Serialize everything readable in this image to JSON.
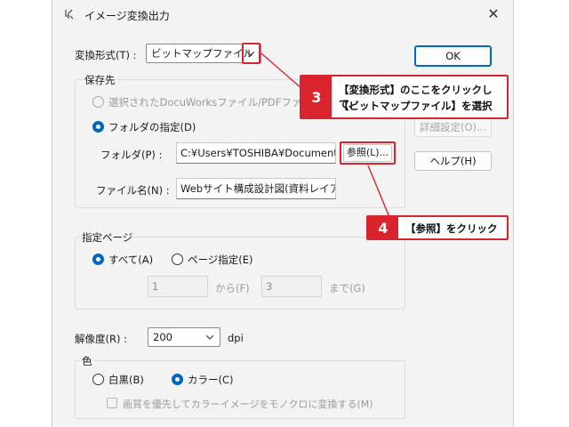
{
  "window": {
    "title": "イメージ変換出力"
  },
  "format": {
    "label": "変換形式(T) :",
    "value": "ビットマップファイル"
  },
  "save_group": {
    "title": "保存先",
    "option_selected_file": "選択されたDocuWorksファイル/PDFファイル",
    "option_folder": "フォルダの指定(D)",
    "folder_label": "フォルダ(P) :",
    "folder_value": "C:¥Users¥TOSHIBA¥Documents¥",
    "browse_button": "参照(L)...",
    "filename_label": "ファイル名(N) :",
    "filename_value": "Webサイト構成設計図(資料レイアウ"
  },
  "page_group": {
    "title": "指定ページ",
    "option_all": "すべて(A)",
    "option_range": "ページ指定(E)",
    "from_value": "1",
    "from_label": "から(F)",
    "to_value": "3",
    "to_label": "まで(G)"
  },
  "resolution": {
    "label": "解像度(R) :",
    "value": "200",
    "unit": "dpi"
  },
  "color_group": {
    "title": "色",
    "option_mono": "白黒(B)",
    "option_color": "カラー(C)",
    "checkbox_label": "画質を優先してカラーイメージをモノクロに変換する(M)"
  },
  "buttons": {
    "ok": "OK",
    "detail": "詳細設定(O)...",
    "help": "ヘルプ(H)"
  },
  "callouts": {
    "step3_num": "3",
    "step3_line1": "【変換形式】のここをクリックして、",
    "step3_line2": "【ビットマップファイル】を選択",
    "step4_num": "4",
    "step4_text": "【参照】をクリック"
  },
  "colors": {
    "accent": "#0067c0",
    "callout_red": "#d9232d"
  }
}
